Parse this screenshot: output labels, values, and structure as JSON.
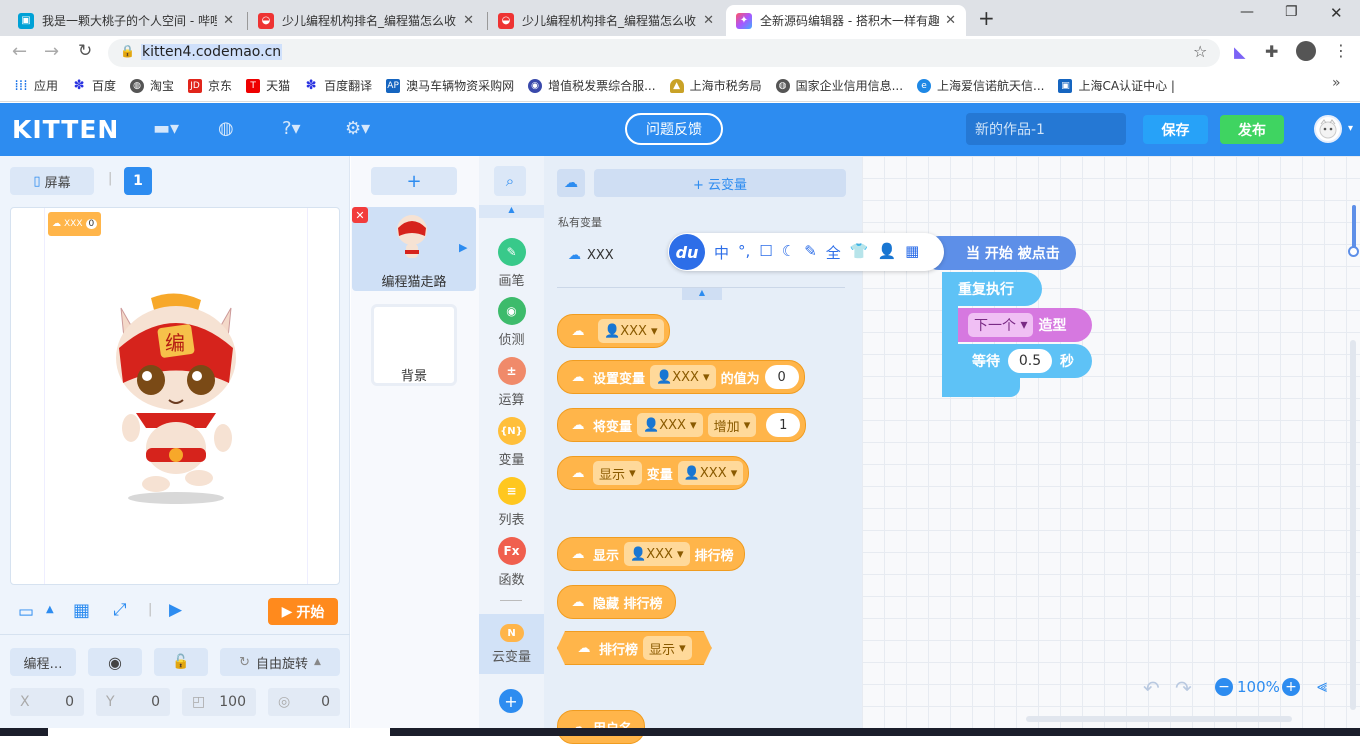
{
  "browser": {
    "tabs": [
      {
        "title": "我是一颗大桃子的个人空间 - 哔哩"
      },
      {
        "title": "少儿编程机构排名_编程猫怎么收"
      },
      {
        "title": "少儿编程机构排名_编程猫怎么收"
      },
      {
        "title": "全新源码编辑器 - 搭积木一样有趣"
      }
    ],
    "url": "kitten4.codemao.cn",
    "bookmarks": [
      "应用",
      "百度",
      "淘宝",
      "京东",
      "天猫",
      "百度翻译",
      "澳马车辆物资采购网",
      "增值税发票综合服...",
      "上海市税务局",
      "国家企业信用信息...",
      "上海爱信诺航天信...",
      "上海CA认证中心 |"
    ]
  },
  "app": {
    "logo": "KITTEN",
    "feedback": "问题反馈",
    "works_name": "新的作品-1",
    "save": "保存",
    "publish": "发布"
  },
  "stage": {
    "screen_label": "屏幕",
    "screen_count": "1",
    "var_monitor_name": "XXX",
    "var_monitor_value": "0",
    "start": "开始"
  },
  "sprite_props": {
    "name": "编程…",
    "rotation": "自由旋转",
    "x_label": "X",
    "x": "0",
    "y_label": "Y",
    "y": "0",
    "size": "100",
    "direction": "0"
  },
  "sprites": {
    "add": "+",
    "selected": "编程猫走路",
    "background": "背景"
  },
  "categories": [
    "画笔",
    "侦测",
    "运算",
    "变量",
    "列表",
    "函数",
    "云变量"
  ],
  "category_icons": {
    "pen": "✎",
    "sense": "◉",
    "op": "±",
    "var": "{N}",
    "list": "≡",
    "fn": "Fx",
    "cloud": "N"
  },
  "palette": {
    "add_cloud_var": "+ 云变量",
    "private_vars": "私有变量",
    "var_name": "XXX",
    "blocks": {
      "b1_var": "XXX",
      "b2_label": "设置变量",
      "b2_var": "XXX",
      "b2_mid": "的值为",
      "b2_val": "0",
      "b3_label": "将变量",
      "b3_var": "XXX",
      "b3_op": "增加",
      "b3_val": "1",
      "b4_label": "显示",
      "b4_mid": "变量",
      "b4_var": "XXX",
      "b5_label": "显示",
      "b5_var": "XXX",
      "b5_end": "排行榜",
      "b6_label": "隐藏 排行榜",
      "b7_label": "排行榜",
      "b7_opt": "显示",
      "b8_label": "用户名"
    }
  },
  "ime_toolbar": [
    "中",
    "°,",
    "☐",
    "☾",
    "✎",
    "全",
    "👕",
    "👤",
    "▦"
  ],
  "ime_logo": "du",
  "script": {
    "hat": "当 开始 被点击",
    "loop": "重复执行",
    "next_costume": "下一个",
    "costume": "造型",
    "wait": "等待",
    "wait_val": "0.5",
    "seconds": "秒"
  },
  "zoom": "100%",
  "colors": {
    "header": "#2d8cf0",
    "cloud_block": "#ffb54a",
    "event_block": "#5d8fe8",
    "control_block": "#5ec2f6",
    "looks_block": "#d678e0"
  }
}
